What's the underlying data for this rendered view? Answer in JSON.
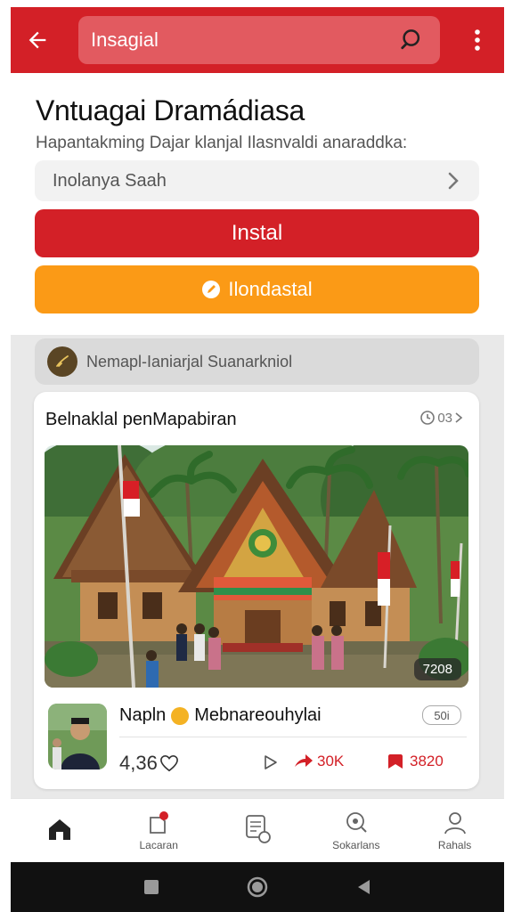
{
  "appbar": {
    "search_text": "Insagial",
    "back_icon": "arrow-left-icon",
    "search_icon": "search-icon",
    "more_icon": "more-vertical-icon"
  },
  "header": {
    "title": "Vntuagai Dramádiasa",
    "subtitle": "Hapantakming Dajar klanjal Ilasnvaldi anaraddka:"
  },
  "selector": {
    "value": "Inolanya Saah"
  },
  "buttons": {
    "install": "Instal",
    "secondary": "Ilondastal"
  },
  "channel": {
    "text": "Nemapl-Ianiarjal Suanarkniol"
  },
  "card": {
    "title": "Belnaklal penMapabiran",
    "meta": "03",
    "photo_badge": "7208",
    "author": "Napln",
    "author_handle": "Mebnareouhylai",
    "tag": "50i",
    "likes": "4,36",
    "shares": "30K",
    "saves": "3820"
  },
  "bottom_nav": [
    {
      "label": "",
      "icon": "home-icon"
    },
    {
      "label": "Lacaran",
      "icon": "notification-icon"
    },
    {
      "label": "",
      "icon": "chat-icon"
    },
    {
      "label": "Sokarlans",
      "icon": "search-icon"
    },
    {
      "label": "Rahals",
      "icon": "profile-icon"
    }
  ],
  "colors": {
    "brand_red": "#d32027",
    "accent_orange": "#fb9a16"
  }
}
